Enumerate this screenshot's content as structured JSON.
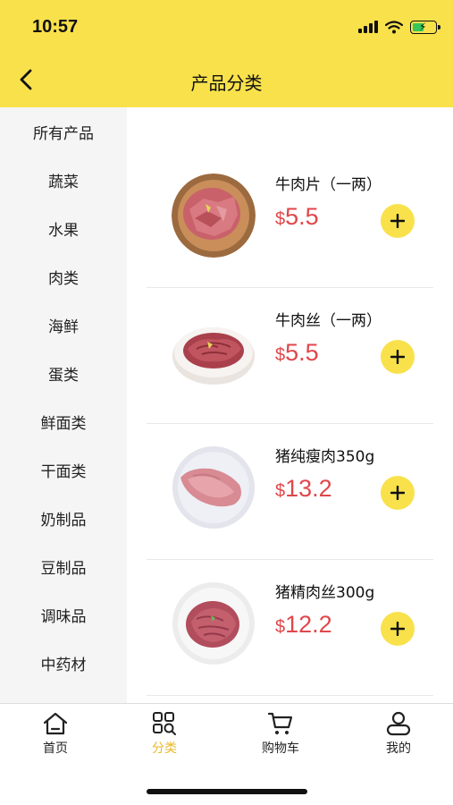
{
  "status": {
    "time": "10:57"
  },
  "header": {
    "title": "产品分类"
  },
  "categories": [
    "所有产品",
    "蔬菜",
    "水果",
    "肉类",
    "海鲜",
    "蛋类",
    "鲜面类",
    "干面类",
    "奶制品",
    "豆制品",
    "调味品",
    "中药材"
  ],
  "products": [
    {
      "name": "牛肉片（一两）",
      "currency": "$",
      "price": "5.5",
      "image": "beef-slices-on-wooden-plate"
    },
    {
      "name": "牛肉丝（一两）",
      "currency": "$",
      "price": "5.5",
      "image": "beef-shreds-on-plate"
    },
    {
      "name": "猪纯瘦肉350g",
      "currency": "$",
      "price": "13.2",
      "image": "lean-pork-on-plate"
    },
    {
      "name": "猪精肉丝300g",
      "currency": "$",
      "price": "12.2",
      "image": "pork-shreds-on-plate"
    }
  ],
  "tabs": [
    {
      "label": "首页",
      "icon": "home-icon"
    },
    {
      "label": "分类",
      "icon": "category-grid-icon",
      "active": true
    },
    {
      "label": "购物车",
      "icon": "cart-icon"
    },
    {
      "label": "我的",
      "icon": "user-icon"
    }
  ],
  "colors": {
    "accent": "#f9e14b",
    "price": "#e0474b",
    "active_tab": "#e8b92a",
    "sidebar": "#f5f5f5"
  }
}
